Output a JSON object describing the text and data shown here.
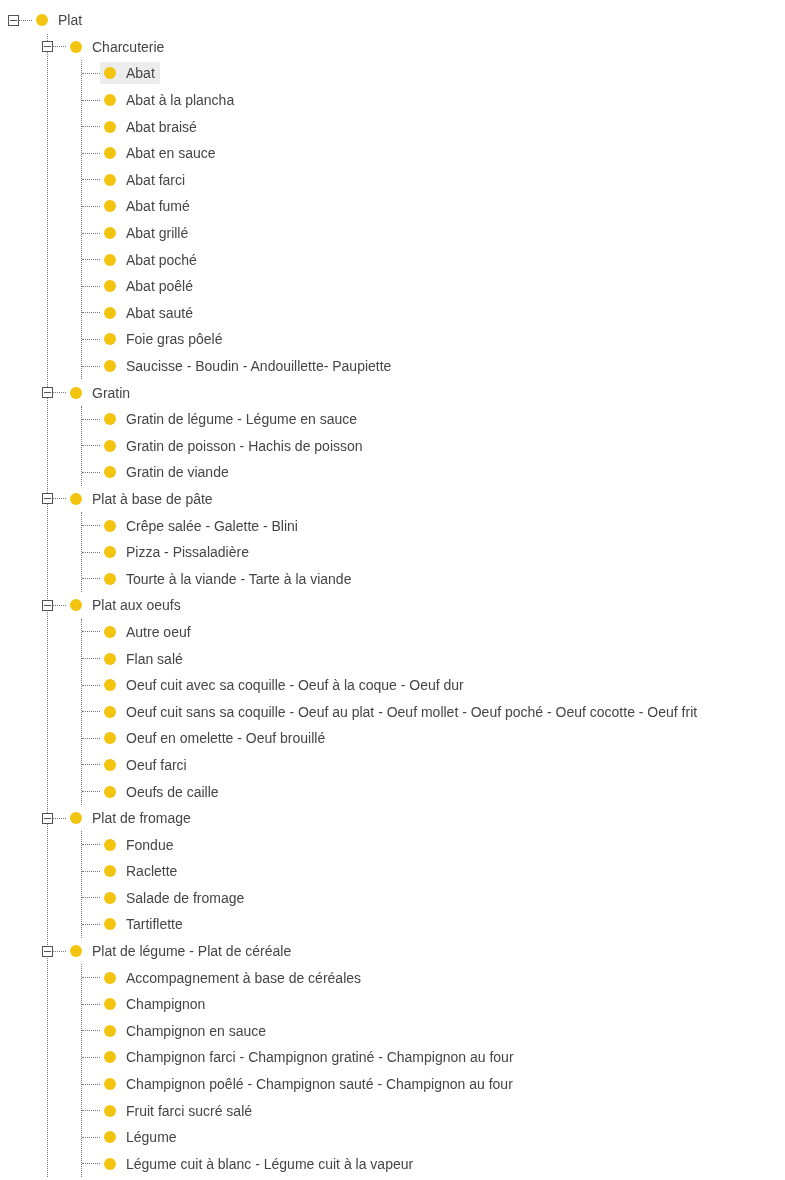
{
  "tree": [
    {
      "label": "Plat",
      "expanded": true,
      "selected": false,
      "children": [
        {
          "label": "Charcuterie",
          "expanded": true,
          "selected": false,
          "children": [
            {
              "label": "Abat",
              "selected": true
            },
            {
              "label": "Abat à la plancha",
              "selected": false
            },
            {
              "label": "Abat braisé",
              "selected": false
            },
            {
              "label": "Abat en sauce",
              "selected": false
            },
            {
              "label": "Abat farci",
              "selected": false
            },
            {
              "label": "Abat fumé",
              "selected": false
            },
            {
              "label": "Abat grillé",
              "selected": false
            },
            {
              "label": "Abat poché",
              "selected": false
            },
            {
              "label": "Abat poêlé",
              "selected": false
            },
            {
              "label": "Abat sauté",
              "selected": false
            },
            {
              "label": "Foie gras pôelé",
              "selected": false
            },
            {
              "label": "Saucisse - Boudin - Andouillette- Paupiette",
              "selected": false
            }
          ]
        },
        {
          "label": "Gratin",
          "expanded": true,
          "selected": false,
          "children": [
            {
              "label": "Gratin de légume - Légume en sauce",
              "selected": false
            },
            {
              "label": "Gratin de poisson - Hachis de poisson",
              "selected": false
            },
            {
              "label": "Gratin de viande",
              "selected": false
            }
          ]
        },
        {
          "label": "Plat à base de pâte",
          "expanded": true,
          "selected": false,
          "children": [
            {
              "label": "Crêpe salée - Galette - Blini",
              "selected": false
            },
            {
              "label": "Pizza - Pissaladière",
              "selected": false
            },
            {
              "label": "Tourte à la viande - Tarte à la viande",
              "selected": false
            }
          ]
        },
        {
          "label": "Plat aux oeufs",
          "expanded": true,
          "selected": false,
          "children": [
            {
              "label": "Autre oeuf",
              "selected": false
            },
            {
              "label": "Flan salé",
              "selected": false
            },
            {
              "label": "Oeuf cuit avec sa coquille - Oeuf à la coque - Oeuf dur",
              "selected": false
            },
            {
              "label": "Oeuf cuit sans sa coquille - Oeuf au plat - Oeuf mollet - Oeuf poché - Oeuf cocotte - Oeuf frit",
              "selected": false
            },
            {
              "label": "Oeuf en omelette - Oeuf brouillé",
              "selected": false
            },
            {
              "label": "Oeuf farci",
              "selected": false
            },
            {
              "label": "Oeufs de caille",
              "selected": false
            }
          ]
        },
        {
          "label": "Plat de fromage",
          "expanded": true,
          "selected": false,
          "children": [
            {
              "label": "Fondue",
              "selected": false
            },
            {
              "label": "Raclette",
              "selected": false
            },
            {
              "label": "Salade de fromage",
              "selected": false
            },
            {
              "label": "Tartiflette",
              "selected": false
            }
          ]
        },
        {
          "label": "Plat de légume - Plat de céréale",
          "expanded": true,
          "selected": false,
          "children": [
            {
              "label": "Accompagnement à base de céréales",
              "selected": false
            },
            {
              "label": "Champignon",
              "selected": false
            },
            {
              "label": "Champignon en sauce",
              "selected": false
            },
            {
              "label": "Champignon farci - Champignon gratiné - Champignon au four",
              "selected": false
            },
            {
              "label": "Champignon poêlé - Champignon sauté - Champignon au four",
              "selected": false
            },
            {
              "label": "Fruit farci sucré salé",
              "selected": false
            },
            {
              "label": "Légume",
              "selected": false
            },
            {
              "label": "Légume cuit à blanc - Légume cuit à la vapeur",
              "selected": false
            }
          ]
        }
      ]
    }
  ]
}
